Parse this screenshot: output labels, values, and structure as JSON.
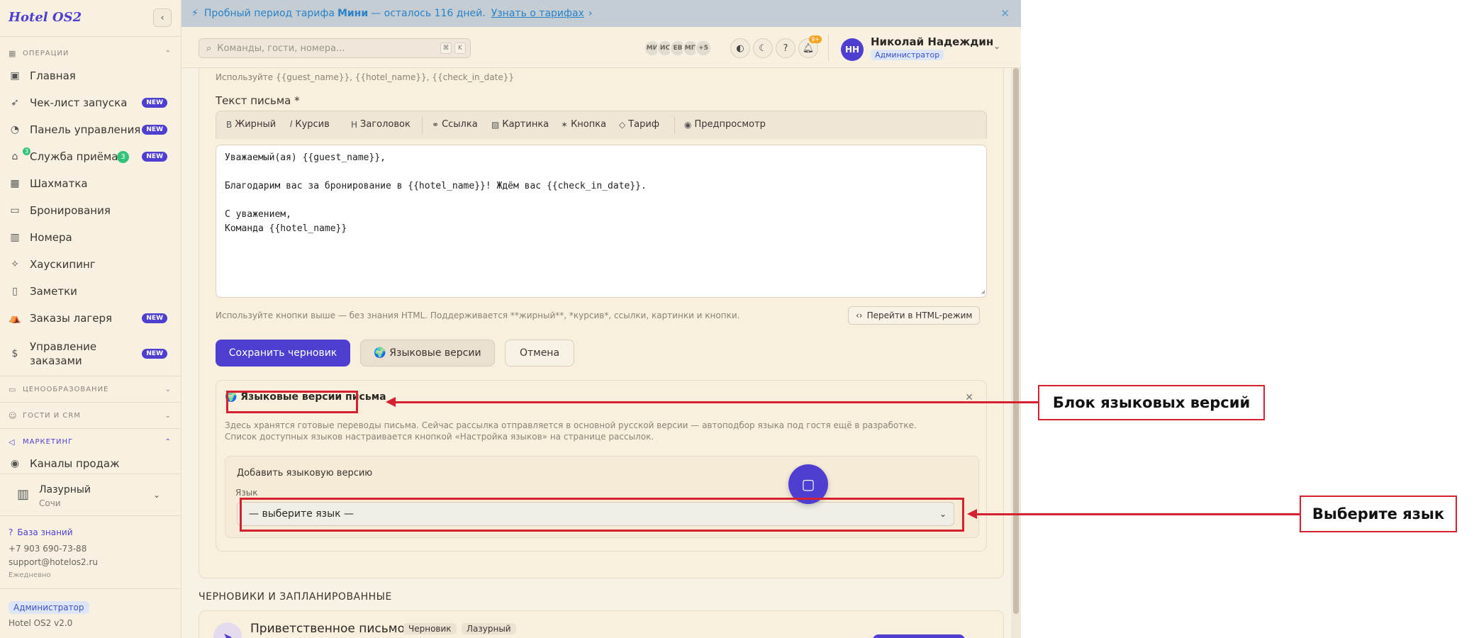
{
  "app": {
    "logo": "Hotel OS2",
    "version": "Hotel OS2 v2.0"
  },
  "sidebar": {
    "sections": {
      "operations": "ОПЕРАЦИИ",
      "pricing": "ЦЕНООБРАЗОВАНИЕ",
      "guests": "ГОСТИ И CRM",
      "marketing": "МАРКЕТИНГ"
    },
    "items": [
      {
        "label": "Главная"
      },
      {
        "label": "Чек-лист запуска",
        "badge": "NEW"
      },
      {
        "label": "Панель управления",
        "badge": "NEW"
      },
      {
        "label": "Служба приёма",
        "count": "3",
        "badge": "NEW"
      },
      {
        "label": "Шахматка"
      },
      {
        "label": "Бронирования"
      },
      {
        "label": "Номера"
      },
      {
        "label": "Хаускипинг"
      },
      {
        "label": "Заметки"
      },
      {
        "label": "Заказы лагеря",
        "badge": "NEW"
      },
      {
        "label": "Управление заказами",
        "badge": "NEW"
      }
    ],
    "marketing_items": [
      {
        "label": "Каналы продаж"
      }
    ],
    "hotel": {
      "name": "Лазурный",
      "city": "Сочи"
    },
    "knowledge_base": "База знаний",
    "phone": "+7 903 690-73-88",
    "email": "support@hotelos2.ru",
    "hours": "Ежедневно",
    "role": "Администратор"
  },
  "banner": {
    "prefix": "Пробный период тарифа",
    "plan": "Мини",
    "suffix": "— осталось 116 дней.",
    "link": "Узнать о тарифах"
  },
  "header": {
    "search_placeholder": "Команды, гости, номера...",
    "kbd": [
      "⌘",
      "K"
    ],
    "avatars": [
      "МИ",
      "ИС",
      "ЕВ",
      "МП",
      "+5"
    ],
    "notif_count": "9+",
    "user": {
      "initials": "НН",
      "name": "Николай Надеждин",
      "role": "Администратор"
    }
  },
  "form": {
    "vars_hint": "Используйте {{guest_name}}, {{hotel_name}}, {{check_in_date}}",
    "body_label": "Текст письма *",
    "toolbar": {
      "bold": "Жирный",
      "italic": "Курсив",
      "heading": "Заголовок",
      "link": "Ссылка",
      "image": "Картинка",
      "button": "Кнопка",
      "tariff": "Тариф",
      "preview": "Предпросмотр"
    },
    "body_lines": [
      "Уважаемый(ая) {{guest_name}},",
      "",
      "Благодарим вас за бронирование в {{hotel_name}}! Ждём вас {{check_in_date}}.",
      "",
      "С уважением,",
      "Команда {{hotel_name}}"
    ],
    "editor_hint": "Используйте кнопки выше — без знания HTML. Поддерживается **жирный**, *курсив*, ссылки, картинки и кнопки.",
    "html_mode": "Перейти в HTML-режим",
    "save_draft": "Сохранить черновик",
    "lang_versions": "🌍 Языковые версии",
    "cancel": "Отмена"
  },
  "lang_block": {
    "title": "🌍 Языковые версии письма",
    "description": "Здесь хранятся готовые переводы письма. Сейчас рассылка отправляется в основной русской версии — автоподбор языка под гостя ещё в разработке. Список доступных языков настраивается кнопкой «Настройка языков» на странице рассылок.",
    "add_title": "Добавить языковую версию",
    "lang_label": "Язык",
    "select_value": "— выберите язык —"
  },
  "drafts": {
    "heading": "ЧЕРНОВИКИ И ЗАПЛАНИРОВАННЫЕ",
    "first": {
      "title": "Приветственное письмо",
      "tags": [
        "Черновик",
        "Лазурный"
      ]
    }
  },
  "callouts": {
    "block": "Блок языковых версий",
    "select": "Выберите язык"
  },
  "colors": {
    "accent": "#4f3fd0",
    "callout": "#d62230",
    "new_badge": "#4f3fd0",
    "count_badge": "#33c27a"
  }
}
